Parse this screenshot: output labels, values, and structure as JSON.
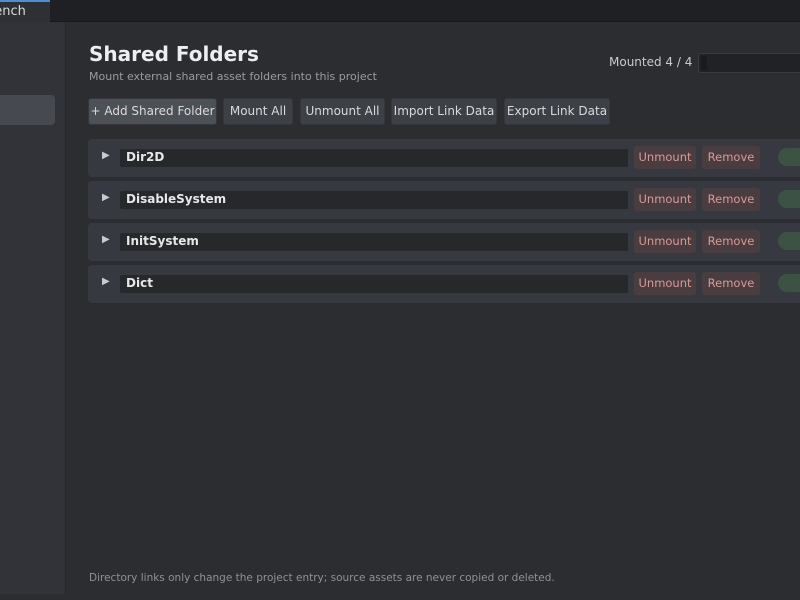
{
  "tab": {
    "title": "bench"
  },
  "header": {
    "title": "Shared Folders",
    "subtitle": "Mount external shared asset folders into this project",
    "mounted_label": "Mounted 4 / 4"
  },
  "toolbar": {
    "add_label": "+ Add Shared Folder",
    "mount_all_label": "Mount All",
    "unmount_all_label": "Unmount All",
    "import_label": "Import Link Data",
    "export_label": "Export Link Data"
  },
  "folders": [
    {
      "name": "Dir2D",
      "unmount_label": "Unmount",
      "remove_label": "Remove",
      "mounted": true
    },
    {
      "name": "DisableSystem",
      "unmount_label": "Unmount",
      "remove_label": "Remove",
      "mounted": true
    },
    {
      "name": "InitSystem",
      "unmount_label": "Unmount",
      "remove_label": "Remove",
      "mounted": true
    },
    {
      "name": "Dict",
      "unmount_label": "Unmount",
      "remove_label": "Remove",
      "mounted": true
    }
  ],
  "icons": {
    "expand": "caret-right-icon"
  },
  "colors": {
    "accent": "#4a90d9",
    "danger_text": "#d99a97",
    "toggle_on": "#6fbf83"
  },
  "footer": {
    "note": "Directory links only change the project entry; source assets are never copied or deleted."
  }
}
